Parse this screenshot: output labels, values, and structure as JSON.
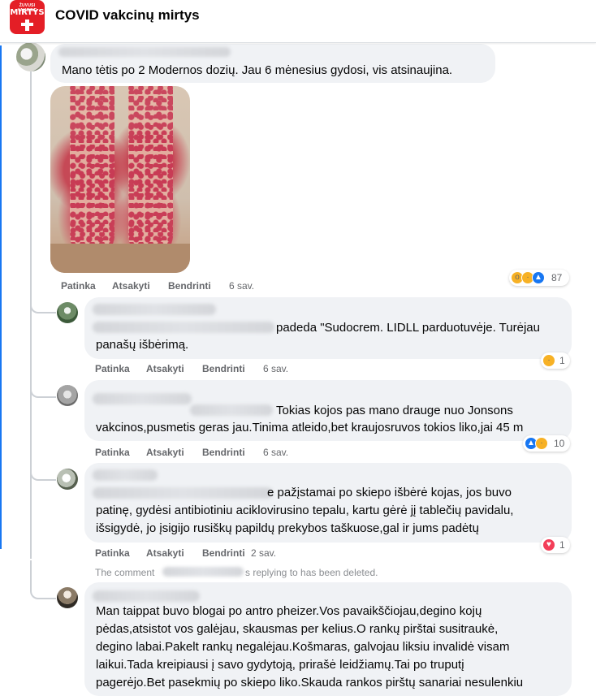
{
  "header": {
    "group_title": "COVID vakcinų mirtys",
    "logo_top": "ŽUVUSI VAKCINE",
    "logo_main": "MIRTYS"
  },
  "comments": [
    {
      "text": "Mano tėtis po 2 Modernos dozių. Jau 6 mėnesius gydosi, vis atsinaujina.",
      "actions": {
        "like": "Patinka",
        "reply": "Atsakyti",
        "share": "Bendrinti",
        "time": "6 sav."
      },
      "reaction_count": "87"
    },
    {
      "line1": "padeda \"Sudocrem. LIDLL parduotuvėje. Turėjau",
      "line2": "panašų išbėrimą.",
      "actions": {
        "like": "Patinka",
        "reply": "Atsakyti",
        "share": "Bendrinti",
        "time": "6 sav."
      },
      "reaction_count": "1"
    },
    {
      "line1": "Tokias kojos pas mano drauge nuo Jonsons",
      "line2": "vakcinos,pusmetis geras jau.Tinima atleido,bet kraujosruvos tokios liko,jai 45 m",
      "actions": {
        "like": "Patinka",
        "reply": "Atsakyti",
        "share": "Bendrinti",
        "time": "6 sav."
      },
      "reaction_count": "10"
    },
    {
      "line1": "e pažįstamai po skiepo išbėrė kojas, jos buvo",
      "line2": "patinę, gydėsi antibiotiniu aciklovirusino tepalu, kartu gėrė jį tablečių pavidalu,",
      "line3": "išsigydė, jo įsigijo rusiškų papildų prekybos taškuose,gal ir jums padėtų",
      "actions": {
        "like": "Patinka",
        "reply": "Atsakyti",
        "share": "Bendrinti",
        "time": "2 sav."
      },
      "reaction_count": "1"
    },
    {
      "deleted_prefix": "The comment",
      "deleted_suffix": "s replying to has been deleted.",
      "line1": "Man taippat buvo blogai po antro pheizer.Vos pavaikščiojau,degino kojų",
      "line2": "pėdas,atsistot vos galėjau, skausmas per kelius.O rankų pirštai susitraukė,",
      "line3": "degino labai.Pakelt rankų negalėjau.Košmaras, galvojau liksiu invalidė visam",
      "line4": "laikui.Tada kreipiausi į savo gydytoją, prirašė leidžiamų.Tai po truputį",
      "line5": "pagerėjo.Bet pasekmių po skiepo liko.Skauda rankos pirštų sanariai nesulenkiu"
    }
  ],
  "colors": {
    "accent": "#1877f2",
    "bubble": "#f0f2f5",
    "meta": "#65676b",
    "logo": "#e41e26"
  }
}
